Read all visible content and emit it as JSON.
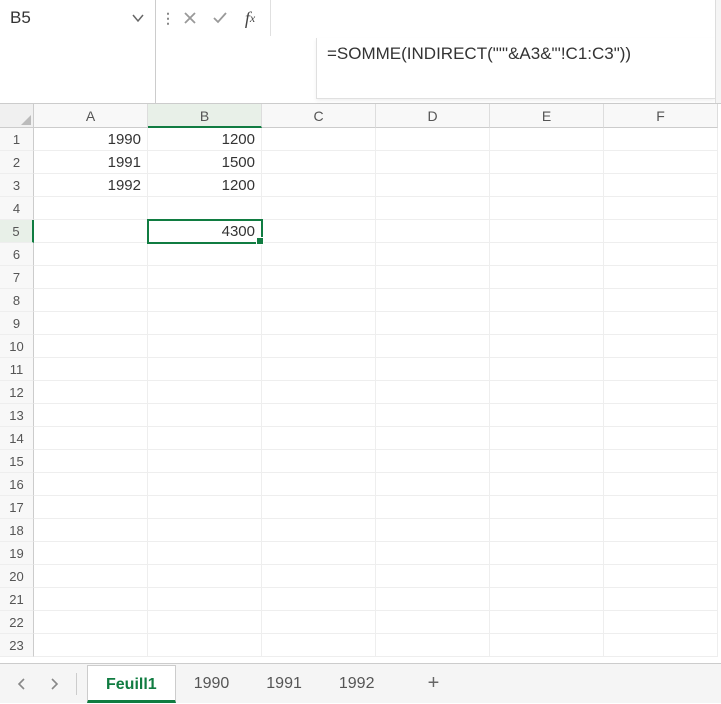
{
  "formula_bar": {
    "name_box": "B5",
    "formula": "=SOMME(INDIRECT(\"'\"&A3&\"'!C1:C3\"))"
  },
  "columns": [
    "A",
    "B",
    "C",
    "D",
    "E",
    "F"
  ],
  "rows": [
    "1",
    "2",
    "3",
    "4",
    "5",
    "6",
    "7",
    "8",
    "9",
    "10",
    "11",
    "12",
    "13",
    "14",
    "15",
    "16",
    "17",
    "18",
    "19",
    "20",
    "21",
    "22",
    "23"
  ],
  "selected": {
    "row": 5,
    "col": "B"
  },
  "cells": {
    "A1": "1990",
    "B1": "1200",
    "A2": "1991",
    "B2": "1500",
    "A3": "1992",
    "B3": "1200",
    "B5": "4300"
  },
  "tabs": {
    "active": "Feuill1",
    "items": [
      "Feuill1",
      "1990",
      "1991",
      "1992"
    ]
  }
}
